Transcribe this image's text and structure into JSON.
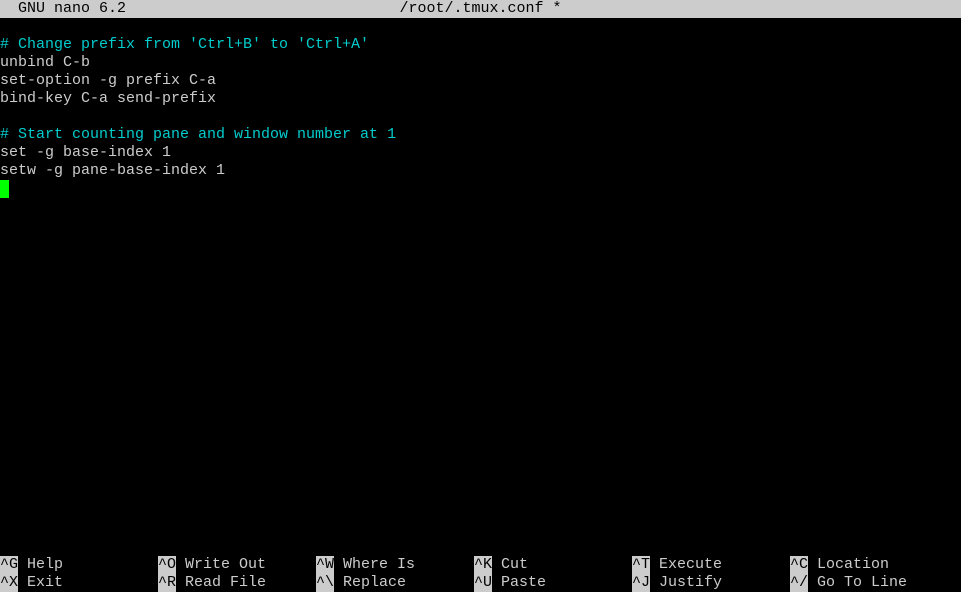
{
  "header": {
    "app": "GNU nano 6.2",
    "filename": "/root/.tmux.conf *"
  },
  "content": {
    "lines": [
      {
        "text": "# Change prefix from 'Ctrl+B' to 'Ctrl+A'",
        "type": "comment"
      },
      {
        "text": "unbind C-b",
        "type": "text"
      },
      {
        "text": "set-option -g prefix C-a",
        "type": "text"
      },
      {
        "text": "bind-key C-a send-prefix",
        "type": "text"
      },
      {
        "text": "",
        "type": "text"
      },
      {
        "text": "# Start counting pane and window number at 1",
        "type": "comment"
      },
      {
        "text": "set -g base-index 1",
        "type": "text"
      },
      {
        "text": "setw -g pane-base-index 1",
        "type": "text"
      }
    ]
  },
  "helpbar": {
    "row1": [
      {
        "key": "^G",
        "label": "Help"
      },
      {
        "key": "^O",
        "label": "Write Out"
      },
      {
        "key": "^W",
        "label": "Where Is"
      },
      {
        "key": "^K",
        "label": "Cut"
      },
      {
        "key": "^T",
        "label": "Execute"
      },
      {
        "key": "^C",
        "label": "Location"
      }
    ],
    "row2": [
      {
        "key": "^X",
        "label": "Exit"
      },
      {
        "key": "^R",
        "label": "Read File"
      },
      {
        "key": "^\\",
        "label": "Replace"
      },
      {
        "key": "^U",
        "label": "Paste"
      },
      {
        "key": "^J",
        "label": "Justify"
      },
      {
        "key": "^/",
        "label": "Go To Line"
      }
    ]
  }
}
